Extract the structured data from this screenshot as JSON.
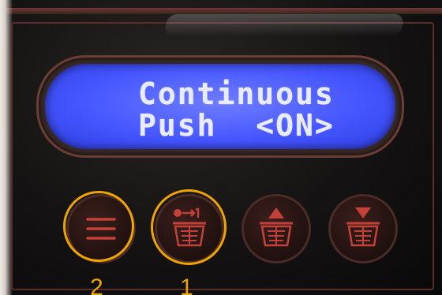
{
  "display": {
    "line1": "Continuous",
    "line2": "Push  <ON>"
  },
  "buttons": [
    {
      "name": "menu-button",
      "icon": "menu-icon"
    },
    {
      "name": "basket-add-button",
      "icon": "basket-plus-one-icon"
    },
    {
      "name": "basket-up-button",
      "icon": "basket-up-arrow-icon"
    },
    {
      "name": "basket-down-button",
      "icon": "basket-down-arrow-icon"
    }
  ],
  "callouts": {
    "label_1": "1",
    "label_2": "2"
  },
  "colors": {
    "lcd": "#4657ff",
    "lcd_text": "#e9ecff",
    "icon": "#c4413a",
    "highlight": "#f0a400"
  }
}
